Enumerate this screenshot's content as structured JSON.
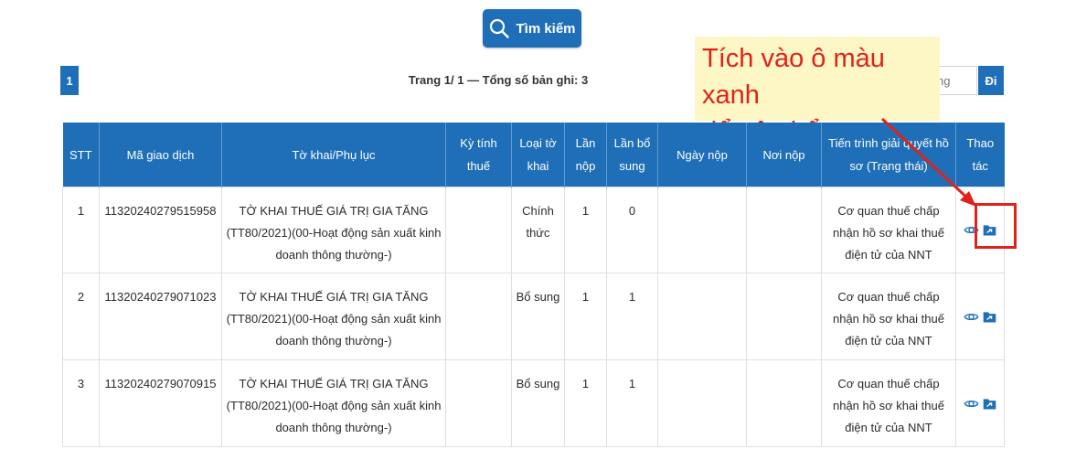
{
  "search": {
    "label": "Tìm kiếm"
  },
  "pagination": {
    "current_page": "1",
    "info": "Trang 1/ 1 — Tổng số bản ghi: 3",
    "page_input_placeholder": "Trang",
    "go_label": "Đi"
  },
  "callout": {
    "line1": "Tích vào ô màu xanh",
    "line2": "để nộp bổ sung",
    "color": "#e0221a"
  },
  "table": {
    "headers": {
      "stt": "STT",
      "ma_giao_dich": "Mã giao dịch",
      "to_khai": "Tờ khai/Phụ lục",
      "ky_tinh_thue": "Kỳ tính thuế",
      "loai_to_khai": "Loại tờ khai",
      "lan_nop": "Lần nộp",
      "lan_bo_sung": "Lần bổ sung",
      "ngay_nop": "Ngày nộp",
      "noi_nop": "Nơi nộp",
      "tien_trinh": "Tiến trình giải quyết hồ sơ (Trạng thái)",
      "thao_tac": "Thao tác"
    },
    "rows": [
      {
        "stt": "1",
        "ma_giao_dich": "11320240279515958",
        "to_khai": "TỜ KHAI THUẾ GIÁ TRỊ GIA TĂNG (TT80/2021)(00-Hoạt động sản xuất kinh doanh thông thường-)",
        "ky_tinh_thue": "",
        "loai_to_khai": "Chính thức",
        "lan_nop": "1",
        "lan_bo_sung": "0",
        "ngay_nop": "",
        "noi_nop": "",
        "tien_trinh": "Cơ quan thuế chấp nhận hồ sơ khai thuế điện tử của NNT"
      },
      {
        "stt": "2",
        "ma_giao_dich": "11320240279071023",
        "to_khai": "TỜ KHAI THUẾ GIÁ TRỊ GIA TĂNG (TT80/2021)(00-Hoạt động sản xuất kinh doanh thông thường-)",
        "ky_tinh_thue": "",
        "loai_to_khai": "Bổ sung",
        "lan_nop": "1",
        "lan_bo_sung": "1",
        "ngay_nop": "",
        "noi_nop": "",
        "tien_trinh": "Cơ quan thuế chấp nhận hồ sơ khai thuế điện tử của NNT"
      },
      {
        "stt": "3",
        "ma_giao_dich": "11320240279070915",
        "to_khai": "TỜ KHAI THUẾ GIÁ TRỊ GIA TĂNG (TT80/2021)(00-Hoạt động sản xuất kinh doanh thông thường-)",
        "ky_tinh_thue": "",
        "loai_to_khai": "Bổ sung",
        "lan_nop": "1",
        "lan_bo_sung": "1",
        "ngay_nop": "",
        "noi_nop": "",
        "tien_trinh": "Cơ quan thuế chấp nhận hồ sơ khai thuế điện tử của NNT"
      }
    ],
    "row_actions": [
      "eye-icon",
      "folder-upload-icon"
    ]
  },
  "colors": {
    "primary": "#1f6fb8",
    "callout_bg": "#fdf7c6",
    "highlight": "#e0221a"
  }
}
